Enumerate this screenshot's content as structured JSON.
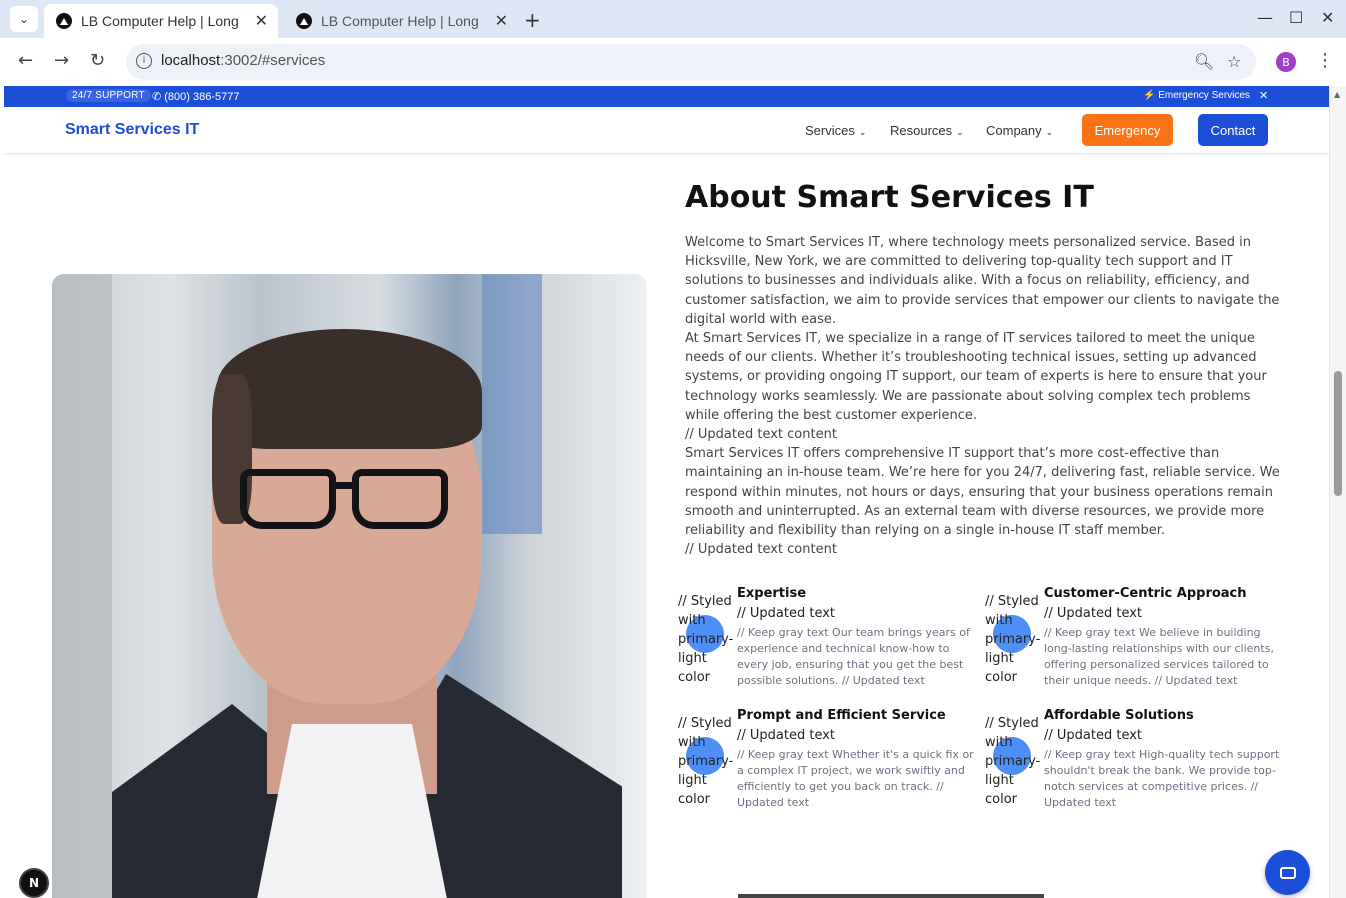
{
  "browser": {
    "tabs": [
      {
        "label": "LB Computer Help | Long",
        "active": true
      },
      {
        "label": "LB Computer Help | Long",
        "active": false
      }
    ],
    "url_host": "localhost",
    "url_rest": ":3002/#services",
    "profile_initial": "B"
  },
  "topbar": {
    "support_badge": "24/7 SUPPORT",
    "phone": "✆ (800) 386-5777",
    "emergency_link": "⚡ Emergency Services",
    "close": "✕"
  },
  "header": {
    "brand": "Smart Services IT",
    "nav": [
      {
        "label": "Services"
      },
      {
        "label": "Resources"
      },
      {
        "label": "Company"
      }
    ],
    "emergency_button": "Emergency",
    "contact_button": "Contact"
  },
  "about": {
    "title": "About Smart Services IT",
    "paragraphs": [
      "Welcome to Smart Services IT, where technology meets personalized service. Based in Hicksville, New York, we are committed to delivering top-quality tech support and IT solutions to businesses and individuals alike. With a focus on reliability, efficiency, and customer satisfaction, we aim to provide services that empower our clients to navigate the digital world with ease.",
      "At Smart Services IT, we specialize in a range of IT services tailored to meet the unique needs of our clients. Whether it’s troubleshooting technical issues, setting up advanced systems, or providing ongoing IT support, our team of experts is here to ensure that your technology works seamlessly. We are passionate about solving complex tech problems while offering the best customer experience.",
      "// Updated text content",
      "Smart Services IT offers comprehensive IT support that’s more cost-effective than maintaining an in-house team. We’re here for you 24/7, delivering fast, reliable service. We respond within minutes, not hours or days, ensuring that your business operations remain smooth and uninterrupted. As an external team with diverse resources, we provide more reliability and flexibility than relying on a single in-house IT staff member.",
      "// Updated text content"
    ]
  },
  "features": [
    {
      "note": "// Styled with primary-light color",
      "title": "Expertise",
      "sub": "// Updated text",
      "desc": "// Keep gray text Our team brings years of experience and technical know-how to every job, ensuring that you get the best possible solutions. // Updated text"
    },
    {
      "note": "// Styled with primary-light color",
      "title": "Customer-Centric Approach",
      "sub": "// Updated text",
      "desc": "// Keep gray text We believe in building long-lasting relationships with our clients, offering personalized services tailored to their unique needs. // Updated text"
    },
    {
      "note": "// Styled with primary-light color",
      "title": "Prompt and Efficient Service",
      "sub": "// Updated text",
      "desc": "// Keep gray text Whether it's a quick fix or a complex IT project, we work swiftly and efficiently to get you back on track. // Updated text"
    },
    {
      "note": "// Styled with primary-light color",
      "title": "Affordable Solutions",
      "sub": "// Updated text",
      "desc": "// Keep gray text High-quality tech support shouldn't break the bank. We provide top-notch services at competitive prices. // Updated text"
    }
  ],
  "next_badge": "N",
  "colors": {
    "brand_blue": "#1d4ed8",
    "emergency_orange": "#f97316",
    "primary_light": "#3b82f6"
  }
}
